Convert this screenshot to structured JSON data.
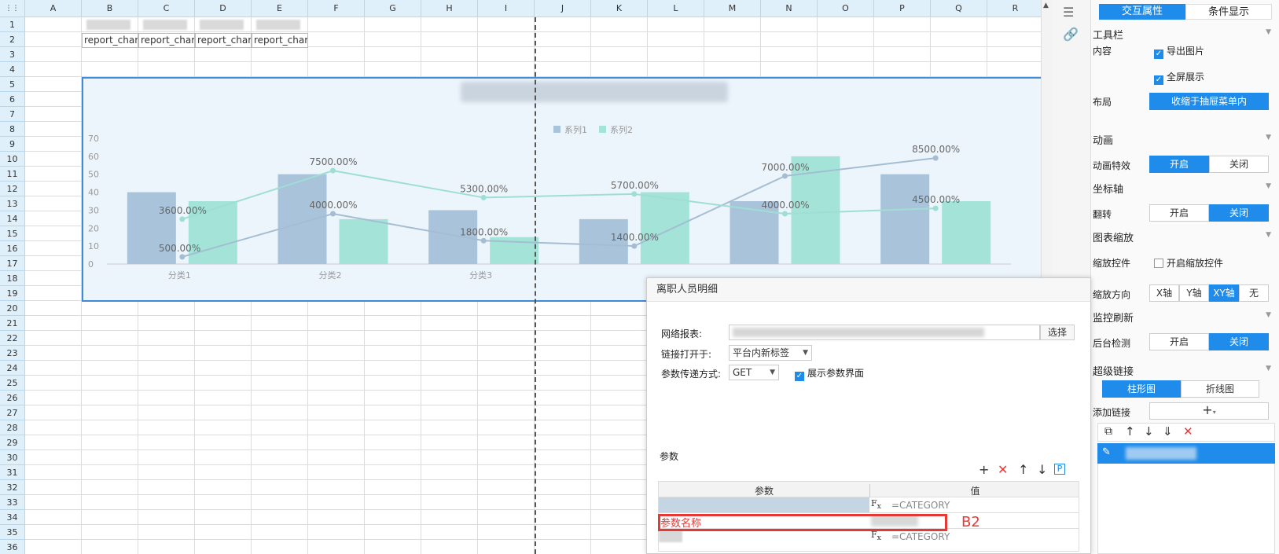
{
  "columns": [
    "A",
    "B",
    "C",
    "D",
    "E",
    "F",
    "G",
    "H",
    "I",
    "J",
    "K",
    "L",
    "M",
    "N",
    "O",
    "P",
    "Q",
    "R"
  ],
  "rows": [
    "1",
    "2",
    "3",
    "4",
    "5",
    "6",
    "7",
    "8",
    "9",
    "10",
    "11",
    "12",
    "13",
    "14",
    "15",
    "16",
    "17",
    "18",
    "19",
    "20",
    "21",
    "22",
    "23",
    "24",
    "25",
    "26",
    "27",
    "28",
    "29",
    "30",
    "31",
    "32",
    "33",
    "34",
    "35",
    "36"
  ],
  "cells_row2": [
    "report_char",
    "report_char",
    "report_char",
    "report_char"
  ],
  "chart_data": {
    "type": "bar",
    "categories": [
      "分类1",
      "分类2",
      "分类3",
      "",
      "",
      ""
    ],
    "legend": [
      "系列1",
      "系列2"
    ],
    "colors": {
      "bar1": "#a9c4da",
      "bar2": "#a3e3d8",
      "line1": "#a5bdd3",
      "line2": "#9fded4"
    },
    "yticks": [
      "70",
      "60",
      "50",
      "40",
      "30",
      "20",
      "10",
      "0"
    ],
    "ylim": [
      0,
      70
    ],
    "series": [
      {
        "name": "系列1",
        "bar": [
          40,
          50,
          30,
          25,
          35,
          50
        ],
        "line": [
          4,
          28,
          13,
          10,
          49,
          59
        ],
        "labels": [
          "500.00%",
          "4000.00%",
          "1800.00%",
          "1400.00%",
          "7000.00%",
          "8500.00%"
        ]
      },
      {
        "name": "系列2",
        "bar": [
          35,
          25,
          15,
          40,
          60,
          35
        ],
        "line": [
          25,
          52,
          37,
          39,
          28,
          31
        ],
        "labels": [
          "3600.00%",
          "7500.00%",
          "5300.00%",
          "5700.00%",
          "4000.00%",
          "4500.00%"
        ]
      }
    ]
  },
  "panel": {
    "tab_interaction": "交互属性",
    "tab_condition": "条件显示",
    "toolbar": "工具栏",
    "content": "内容",
    "export_image": "导出图片",
    "fullscreen": "全屏展示",
    "layout": "布局",
    "layout_value": "收缩于抽屉菜单内",
    "animation": "动画",
    "animation_effect": "动画特效",
    "on": "开启",
    "off": "关闭",
    "axis": "坐标轴",
    "flip": "翻转",
    "zoom": "图表缩放",
    "zoom_control": "缩放控件",
    "enable_zoom": "开启缩放控件",
    "zoom_dir": "缩放方向",
    "dir_x": "X轴",
    "dir_y": "Y轴",
    "dir_xy": "XY轴",
    "dir_none": "无",
    "monitor": "监控刷新",
    "backend_check": "后台检测",
    "hyperlink": "超级链接",
    "tab_bar": "柱形图",
    "tab_line": "折线图",
    "add_link": "添加链接"
  },
  "dialog": {
    "title": "离职人员明细",
    "web_report": "网络报表:",
    "select": "选择",
    "open_in": "链接打开于:",
    "open_in_value": "平台内新标签",
    "pass_method": "参数传递方式:",
    "pass_value": "GET",
    "show_params": "展示参数界面",
    "params": "参数",
    "col_param": "参数",
    "col_value": "值",
    "row1_value": "=CATEGORY",
    "row2_param": "参数名称",
    "row3_value": "=CATEGORY",
    "annotation": "B2"
  }
}
